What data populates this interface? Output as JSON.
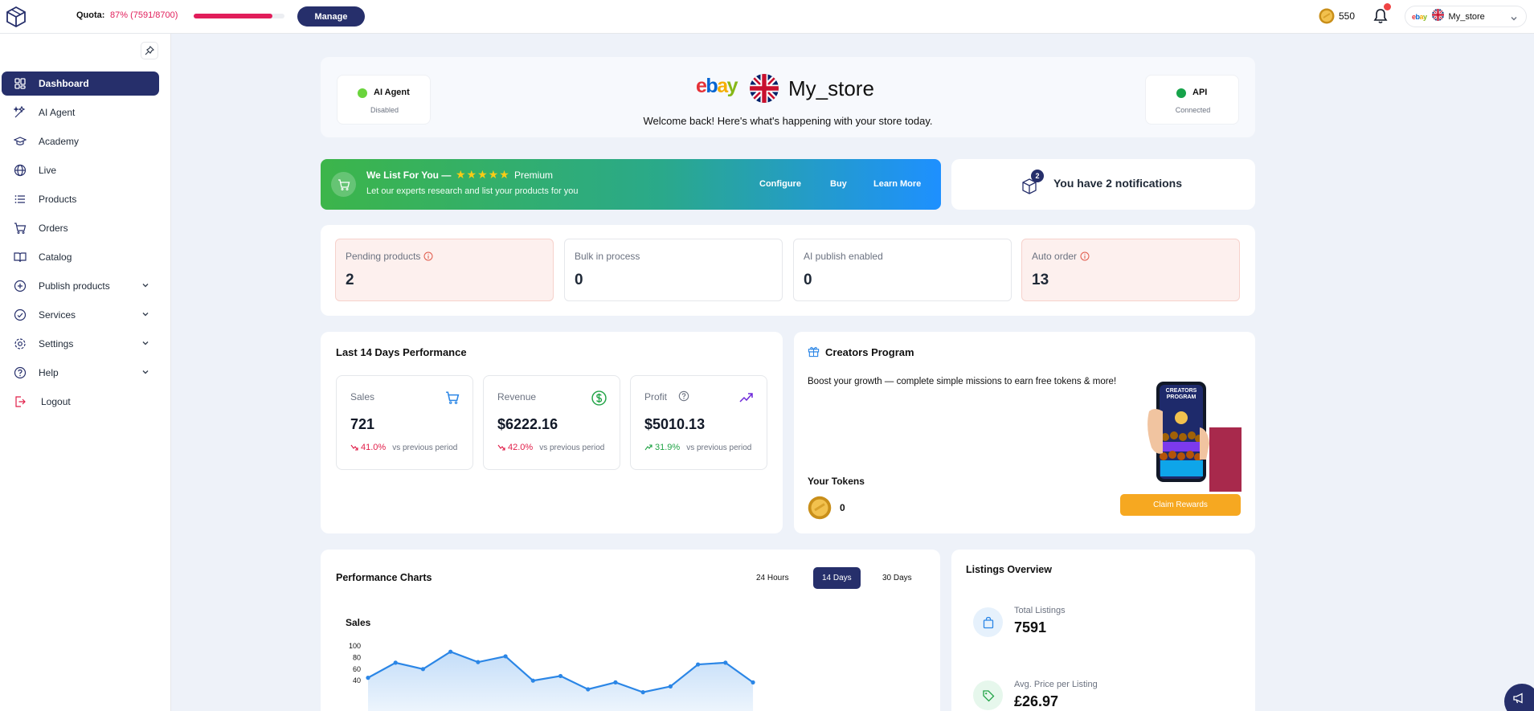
{
  "topbar": {
    "quota_label": "Quota:",
    "quota_value": "87% (7591/8700)",
    "quota_fraction": 0.87,
    "manage_label": "Manage",
    "tokens": "550",
    "store_selector": {
      "marketplace": "ebay",
      "store_name": "My_store"
    }
  },
  "sidebar": {
    "items": [
      {
        "label": "Dashboard",
        "icon": "dashboard-icon",
        "active": true
      },
      {
        "label": "AI Agent",
        "icon": "ai-agent-icon"
      },
      {
        "label": "Academy",
        "icon": "academy-icon"
      },
      {
        "label": "Live",
        "icon": "globe-icon"
      },
      {
        "label": "Products",
        "icon": "list-icon"
      },
      {
        "label": "Orders",
        "icon": "cart-icon"
      },
      {
        "label": "Catalog",
        "icon": "book-icon"
      },
      {
        "label": "Publish products",
        "icon": "plus-circle-icon",
        "expandable": true
      },
      {
        "label": "Services",
        "icon": "check-circle-icon",
        "expandable": true
      },
      {
        "label": "Settings",
        "icon": "gear-icon",
        "expandable": true
      },
      {
        "label": "Help",
        "icon": "help-icon",
        "expandable": true
      },
      {
        "label": "Logout",
        "icon": "logout-icon"
      }
    ]
  },
  "header": {
    "marketplace_logo": "ebay",
    "store_name": "My_store",
    "welcome": "Welcome back! Here's what's happening with your store today.",
    "ai_agent": {
      "title": "AI Agent",
      "status": "Disabled"
    },
    "api": {
      "title": "API",
      "status": "Connected"
    }
  },
  "promo": {
    "title": "We List For You —",
    "stars": "★★★★★",
    "tier": "Premium",
    "subtitle": "Let our experts research and list your products for you",
    "configure": "Configure",
    "buy": "Buy",
    "learn_more": "Learn More"
  },
  "notifications": {
    "count": "2",
    "text": "You have 2 notifications"
  },
  "stats": [
    {
      "label": "Pending products",
      "value": "2"
    },
    {
      "label": "Bulk in process",
      "value": "0"
    },
    {
      "label": "AI publish enabled",
      "value": "0"
    },
    {
      "label": "Auto order",
      "value": "13"
    }
  ],
  "performance": {
    "title": "Last 14 Days Performance",
    "cards": [
      {
        "label": "Sales",
        "value": "721",
        "change": "41.0%",
        "vs": "vs previous period"
      },
      {
        "label": "Revenue",
        "value": "$6222.16",
        "change": "42.0%",
        "vs": "vs previous period"
      },
      {
        "label": "Profit",
        "value": "$5010.13",
        "change": "31.9%",
        "vs": "vs previous period"
      }
    ]
  },
  "creators": {
    "title": "Creators Program",
    "description": "Boost your growth — complete simple missions to earn free tokens & more!",
    "tokens_label": "Your Tokens",
    "tokens_value": "0",
    "claim_label": "Claim Rewards",
    "phone_text": "CREATORS PROGRAM"
  },
  "charts": {
    "title": "Performance Charts",
    "ranges": [
      "24 Hours",
      "14 Days",
      "30 Days"
    ],
    "selected_range": "14 Days",
    "sales_title": "Sales"
  },
  "chart_data": {
    "type": "area",
    "title": "Sales",
    "xlabel": "",
    "ylabel": "",
    "ylim": [
      30,
      100
    ],
    "yticks": [
      "100",
      "80",
      "60",
      "40"
    ],
    "series": [
      {
        "values": [
          45,
          71,
          60,
          90,
          72,
          82,
          40,
          48,
          25,
          37,
          20,
          30,
          68,
          71,
          37
        ]
      }
    ]
  },
  "listings": {
    "title": "Listings Overview",
    "total_label": "Total Listings",
    "total_value": "7591",
    "avg_label": "Avg. Price per Listing",
    "avg_value": "£26.97"
  },
  "colors": {
    "primary": "#262f6b",
    "quota_bar": "#e11d5a",
    "promo_start": "#3cb54a",
    "promo_end": "#1e90ff",
    "status_green": "#3cc63c",
    "claim_button": "#f6a821",
    "chart_line": "#2b86e6"
  }
}
